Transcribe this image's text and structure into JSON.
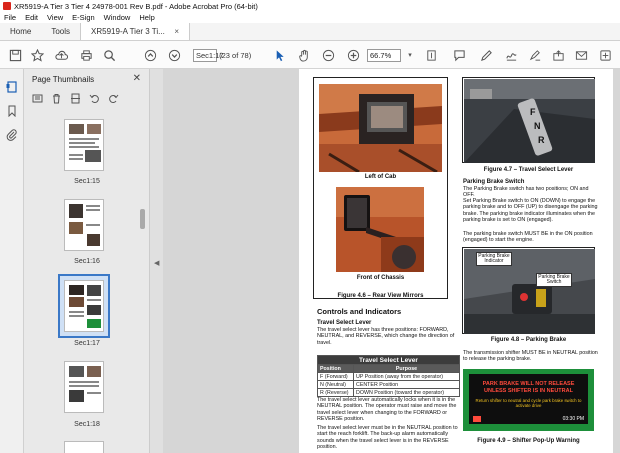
{
  "window": {
    "title": "XR5919-A Tier 3 Tier 4 24978-001 Rev B.pdf - Adobe Acrobat Pro (64-bit)"
  },
  "menu": [
    "File",
    "Edit",
    "View",
    "E-Sign",
    "Window",
    "Help"
  ],
  "tabs": {
    "home": "Home",
    "tools": "Tools",
    "doc": "XR5919-A Tier 3 Ti...",
    "close": "×"
  },
  "toolbar": {
    "page_current": "Sec1:17",
    "page_count": "(23 of 78)",
    "zoom": "66.7%"
  },
  "thumbnails": {
    "title": "Page Thumbnails",
    "items": [
      {
        "label": "Sec1:15"
      },
      {
        "label": "Sec1:16"
      },
      {
        "label": "Sec1:17",
        "selected": true
      },
      {
        "label": "Sec1:18"
      }
    ]
  },
  "page": {
    "fig_left_cab_caption": "Left of Cab",
    "fig_front_chassis_caption": "Front of Chassis",
    "fig46_caption": "Figure 4.6 – Rear View Mirrors",
    "controls_heading": "Controls and Indicators",
    "tsl_heading": "Travel Select Lever",
    "tsl_para": "The travel select lever has three positions: FORWARD, NEUTRAL, and REVERSE, which change the direction of travel.",
    "table": {
      "title": "Travel Select Lever",
      "col1": "Position",
      "col2": "Purpose",
      "rows": [
        [
          "F (Forward)",
          "UP Position (away from the operator)"
        ],
        [
          "N (Neutral)",
          "CENTER Position"
        ],
        [
          "R (Reverse)",
          "DOWN Position (toward the operator)"
        ]
      ]
    },
    "tsl_para2": "The travel select lever automatically locks when it is in the NEUTRAL position. The operator must raise and move the travel select lever when changing to the FORWARD or REVERSE position.",
    "tsl_para3": "The travel select lever must be in the NEUTRAL position to start the reach forklift. The back-up alarm automatically sounds when the travel select lever is in the REVERSE position.",
    "fig47_caption": "Figure 4.7 – Travel Select Lever",
    "pbs_heading": "Parking Brake Switch",
    "pbs_para1": "The Parking Brake switch has two positions; ON and OFF.",
    "pbs_para2": "Set Parking Brake switch to ON (DOWN) to engage the parking brake and to OFF (UP) to disengage the parking brake. The parking brake indicator illuminates when the parking brake is set to ON (engaged).",
    "pbs_para3": "The parking brake switch MUST BE in the ON position (engaged) to start the engine.",
    "callout_indicator": "Parking Brake Indicator",
    "callout_switch": "Parking Brake Switch",
    "fig48_caption": "Figure 4.8 – Parking Brake",
    "shifter_para": "The transmission shifter MUST BE in NEUTRAL position to release the parking brake.",
    "warning_line1": "PARK BRAKE WILL NOT RELEASE",
    "warning_line2": "UNLESS SHIFTER IS IN NEUTRAL",
    "warning_sub": "Return shifter to neutral and cycle park brake switch to activate drive",
    "warning_time": "03:30 PM",
    "fig49_caption": "Figure 4.9 – Shifter Pop-Up Warning"
  },
  "colors": {
    "accent": "#3a78c7",
    "warning_bg": "#1d8f3a",
    "warning_text": "#ff4a3c"
  }
}
